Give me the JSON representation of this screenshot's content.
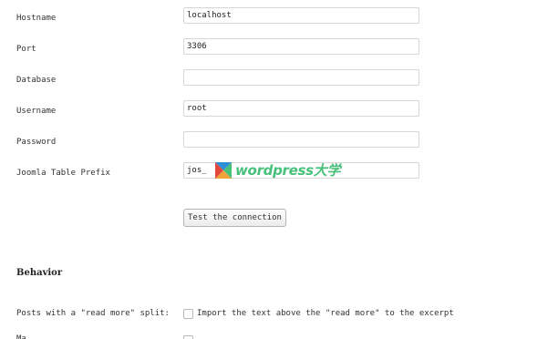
{
  "form": {
    "hostname": {
      "label": "Hostname",
      "value": "localhost"
    },
    "port": {
      "label": "Port",
      "value": "3306"
    },
    "database": {
      "label": "Database",
      "value": ""
    },
    "username": {
      "label": "Username",
      "value": "root"
    },
    "password": {
      "label": "Password",
      "value": ""
    },
    "table_prefix": {
      "label": "Joomla Table Prefix",
      "value": "jos_"
    },
    "test_button_label": "Test the connection"
  },
  "behavior": {
    "title": "Behavior",
    "read_more": {
      "label": "Posts with a \"read more\" split:",
      "option_label": "Import the text above the \"read more\" to the excerpt",
      "checked": false
    },
    "next_row_label": "Ma"
  },
  "watermark": {
    "text": "wordpress大学",
    "colors": {
      "green": "#47c07a",
      "blue": "#2b8fd6",
      "orange": "#f2a23a",
      "red": "#e2483b"
    }
  }
}
